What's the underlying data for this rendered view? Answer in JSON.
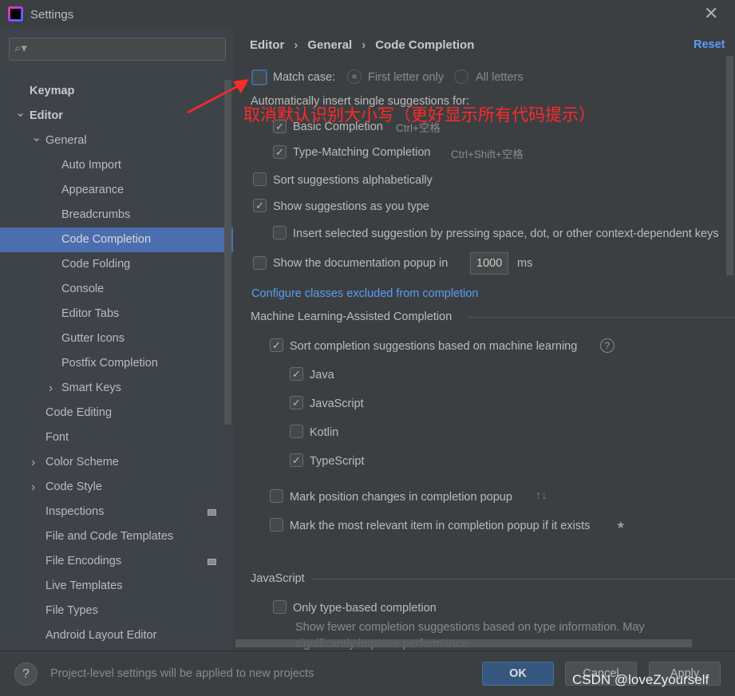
{
  "window": {
    "title": "Settings",
    "close_icon": "close-icon"
  },
  "sidebar": {
    "items": [
      {
        "label": "Keymap",
        "bold": true
      },
      {
        "label": "Editor",
        "bold": true
      },
      {
        "label": "General"
      },
      {
        "label": "Auto Import"
      },
      {
        "label": "Appearance"
      },
      {
        "label": "Breadcrumbs"
      },
      {
        "label": "Code Completion",
        "selected": true
      },
      {
        "label": "Code Folding"
      },
      {
        "label": "Console"
      },
      {
        "label": "Editor Tabs"
      },
      {
        "label": "Gutter Icons"
      },
      {
        "label": "Postfix Completion"
      },
      {
        "label": "Smart Keys"
      },
      {
        "label": "Code Editing"
      },
      {
        "label": "Font"
      },
      {
        "label": "Color Scheme"
      },
      {
        "label": "Code Style"
      },
      {
        "label": "Inspections"
      },
      {
        "label": "File and Code Templates"
      },
      {
        "label": "File Encodings"
      },
      {
        "label": "Live Templates"
      },
      {
        "label": "File Types"
      },
      {
        "label": "Android Layout Editor"
      }
    ]
  },
  "breadcrumb": [
    "Editor",
    "General",
    "Code Completion"
  ],
  "reset": "Reset",
  "match_case": {
    "label": "Match case:",
    "checked": false,
    "opt1": "First letter only",
    "opt2": "All letters"
  },
  "auto_insert_label": "Automatically insert single suggestions for:",
  "annotation": "取消默认识别大小写（更好显示所有代码提示）",
  "basic": {
    "label": "Basic Completion",
    "shortcut": "Ctrl+空格",
    "checked": true
  },
  "typematch": {
    "label": "Type-Matching Completion",
    "shortcut": "Ctrl+Shift+空格",
    "checked": true
  },
  "sort_alpha": {
    "label": "Sort suggestions alphabetically",
    "checked": false
  },
  "show_as_type": {
    "label": "Show suggestions as you type",
    "checked": true
  },
  "insert_selected": {
    "label": "Insert selected suggestion by pressing space, dot, or other context-dependent keys",
    "checked": false
  },
  "doc_popup": {
    "label": "Show the documentation popup in",
    "value": "1000",
    "unit": "ms",
    "checked": false
  },
  "configure_link": "Configure classes excluded from completion",
  "ml_section": "Machine Learning-Assisted Completion",
  "ml_sort": {
    "label": "Sort completion suggestions based on machine learning",
    "checked": true
  },
  "langs": [
    {
      "label": "Java",
      "checked": true
    },
    {
      "label": "JavaScript",
      "checked": true
    },
    {
      "label": "Kotlin",
      "checked": false
    },
    {
      "label": "TypeScript",
      "checked": true
    }
  ],
  "mark_pos": {
    "label": "Mark position changes in completion popup",
    "checked": false
  },
  "mark_rel": {
    "label": "Mark the most relevant item in completion popup if it exists",
    "checked": false
  },
  "js_section": "JavaScript",
  "only_type": {
    "label": "Only type-based completion",
    "checked": false,
    "desc1": "Show fewer completion suggestions based on type information. May",
    "desc2": "significantly improve performance."
  },
  "footer": {
    "help": "?",
    "message": "Project-level settings will be applied to new projects",
    "ok": "OK",
    "cancel": "Cancel",
    "apply": "Apply"
  },
  "watermark": "CSDN @loveZyourself",
  "colors": {
    "accent": "#4b6eaf",
    "link": "#589df6",
    "annotation": "#ff2a2a"
  }
}
